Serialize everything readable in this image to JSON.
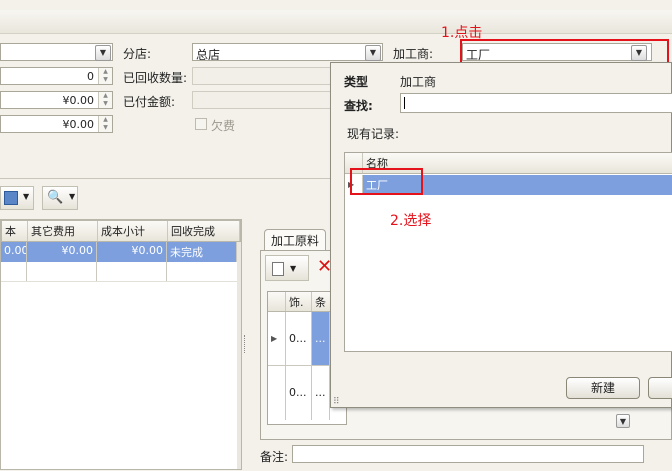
{
  "form": {
    "branch_label": "分店:",
    "branch_value": "总店",
    "processor_label": "加工商:",
    "processor_value": "工厂",
    "returned_qty_label": "已回收数量:",
    "paid_amount_label": "已付金额:",
    "owed_label": "欠费",
    "left_values": [
      "0",
      "¥0.00",
      "¥0.00"
    ]
  },
  "grid": {
    "columns": [
      "本",
      "其它费用",
      "成本小计",
      "回收完成"
    ],
    "rows": [
      [
        "0.00",
        "¥0.00",
        "¥0.00",
        "未完成"
      ]
    ]
  },
  "right_panel": {
    "tab_label": "加工原料",
    "columns": [
      "饰.",
      "条"
    ],
    "rows": [
      "0...",
      "0..."
    ],
    "row_cell": "...",
    "remark_label": "备注:"
  },
  "popup": {
    "type_label": "类型",
    "type_value": "加工商",
    "search_label": "查找:",
    "records_label": "现有记录:",
    "name_header": "名称",
    "records": [
      "工厂"
    ],
    "new_button": "新建"
  },
  "annotations": {
    "step1": "1.点击",
    "step2": "2.选择"
  },
  "colors": {
    "selection": "#7d9fde",
    "annotation": "#e4121b"
  }
}
